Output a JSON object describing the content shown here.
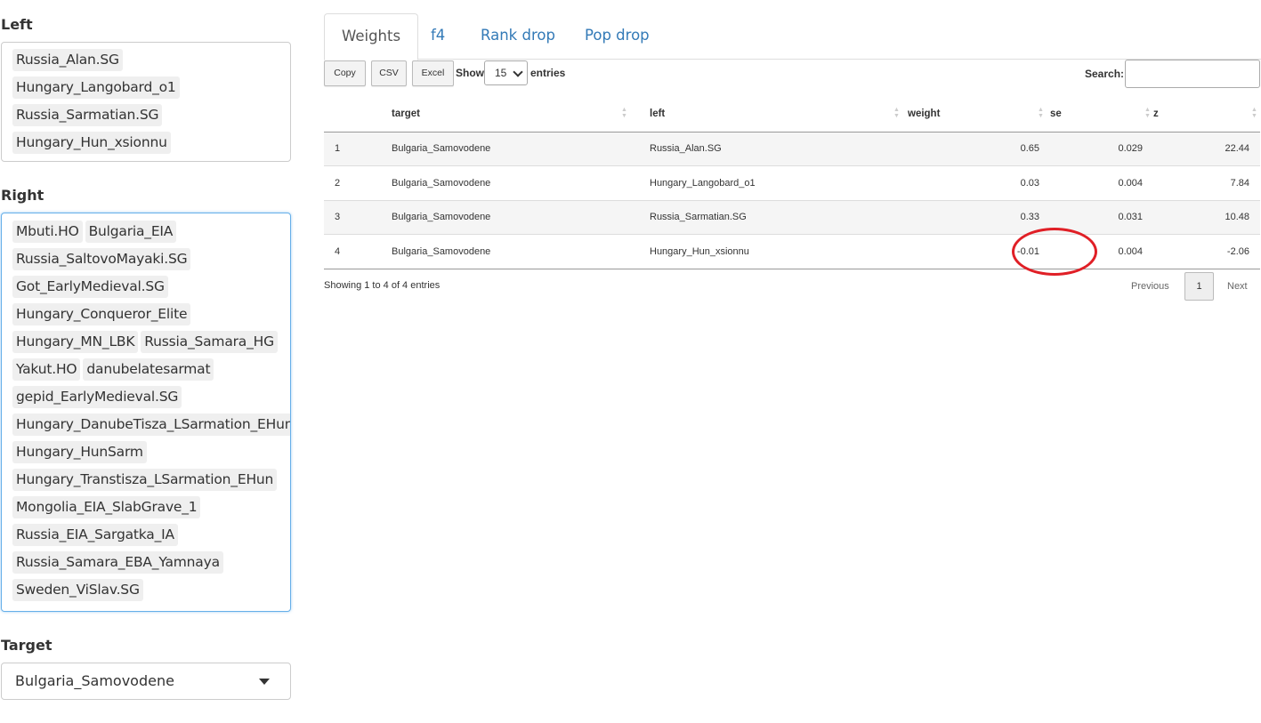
{
  "sidebar": {
    "left": {
      "label": "Left",
      "items": [
        "Russia_Alan.SG",
        "Hungary_Langobard_o1",
        "Russia_Sarmatian.SG",
        "Hungary_Hun_xsionnu"
      ]
    },
    "right": {
      "label": "Right",
      "items": [
        "Mbuti.HO",
        "Bulgaria_EIA",
        "Russia_SaltovoMayaki.SG",
        "Got_EarlyMedieval.SG",
        "Hungary_Conqueror_Elite",
        "Hungary_MN_LBK",
        "Russia_Samara_HG",
        "Yakut.HO",
        "danubelatesarmat",
        "gepid_EarlyMedieval.SG",
        "Hungary_DanubeTisza_LSarmation_EHun",
        "Hungary_HunSarm",
        "Hungary_Transtisza_LSarmation_EHun",
        "Mongolia_EIA_SlabGrave_1",
        "Russia_EIA_Sargatka_IA",
        "Russia_Samara_EBA_Yamnaya",
        "Sweden_ViSlav.SG"
      ]
    },
    "target": {
      "label": "Target",
      "value": "Bulgaria_Samovodene"
    }
  },
  "tabs": [
    "Weights",
    "f4",
    "Rank drop",
    "Pop drop"
  ],
  "toolbar": {
    "copy": "Copy",
    "csv": "CSV",
    "excel": "Excel",
    "show": "Show",
    "entries_value": "15",
    "entries": "entries",
    "search_label": "Search:"
  },
  "table": {
    "headers": [
      "",
      "target",
      "left",
      "weight",
      "se",
      "z"
    ],
    "rows": [
      [
        "1",
        "Bulgaria_Samovodene",
        "Russia_Alan.SG",
        "0.65",
        "0.029",
        "22.44"
      ],
      [
        "2",
        "Bulgaria_Samovodene",
        "Hungary_Langobard_o1",
        "0.03",
        "0.004",
        "7.84"
      ],
      [
        "3",
        "Bulgaria_Samovodene",
        "Russia_Sarmatian.SG",
        "0.33",
        "0.031",
        "10.48"
      ],
      [
        "4",
        "Bulgaria_Samovodene",
        "Hungary_Hun_xsionnu",
        "-0.01",
        "0.004",
        "-2.06"
      ]
    ]
  },
  "footer": {
    "info": "Showing 1 to 4 of 4 entries",
    "previous": "Previous",
    "page": "1",
    "next": "Next"
  },
  "colors": {
    "link": "#337ab7",
    "annotation": "#e01f26",
    "focus_border": "#66afe9"
  }
}
